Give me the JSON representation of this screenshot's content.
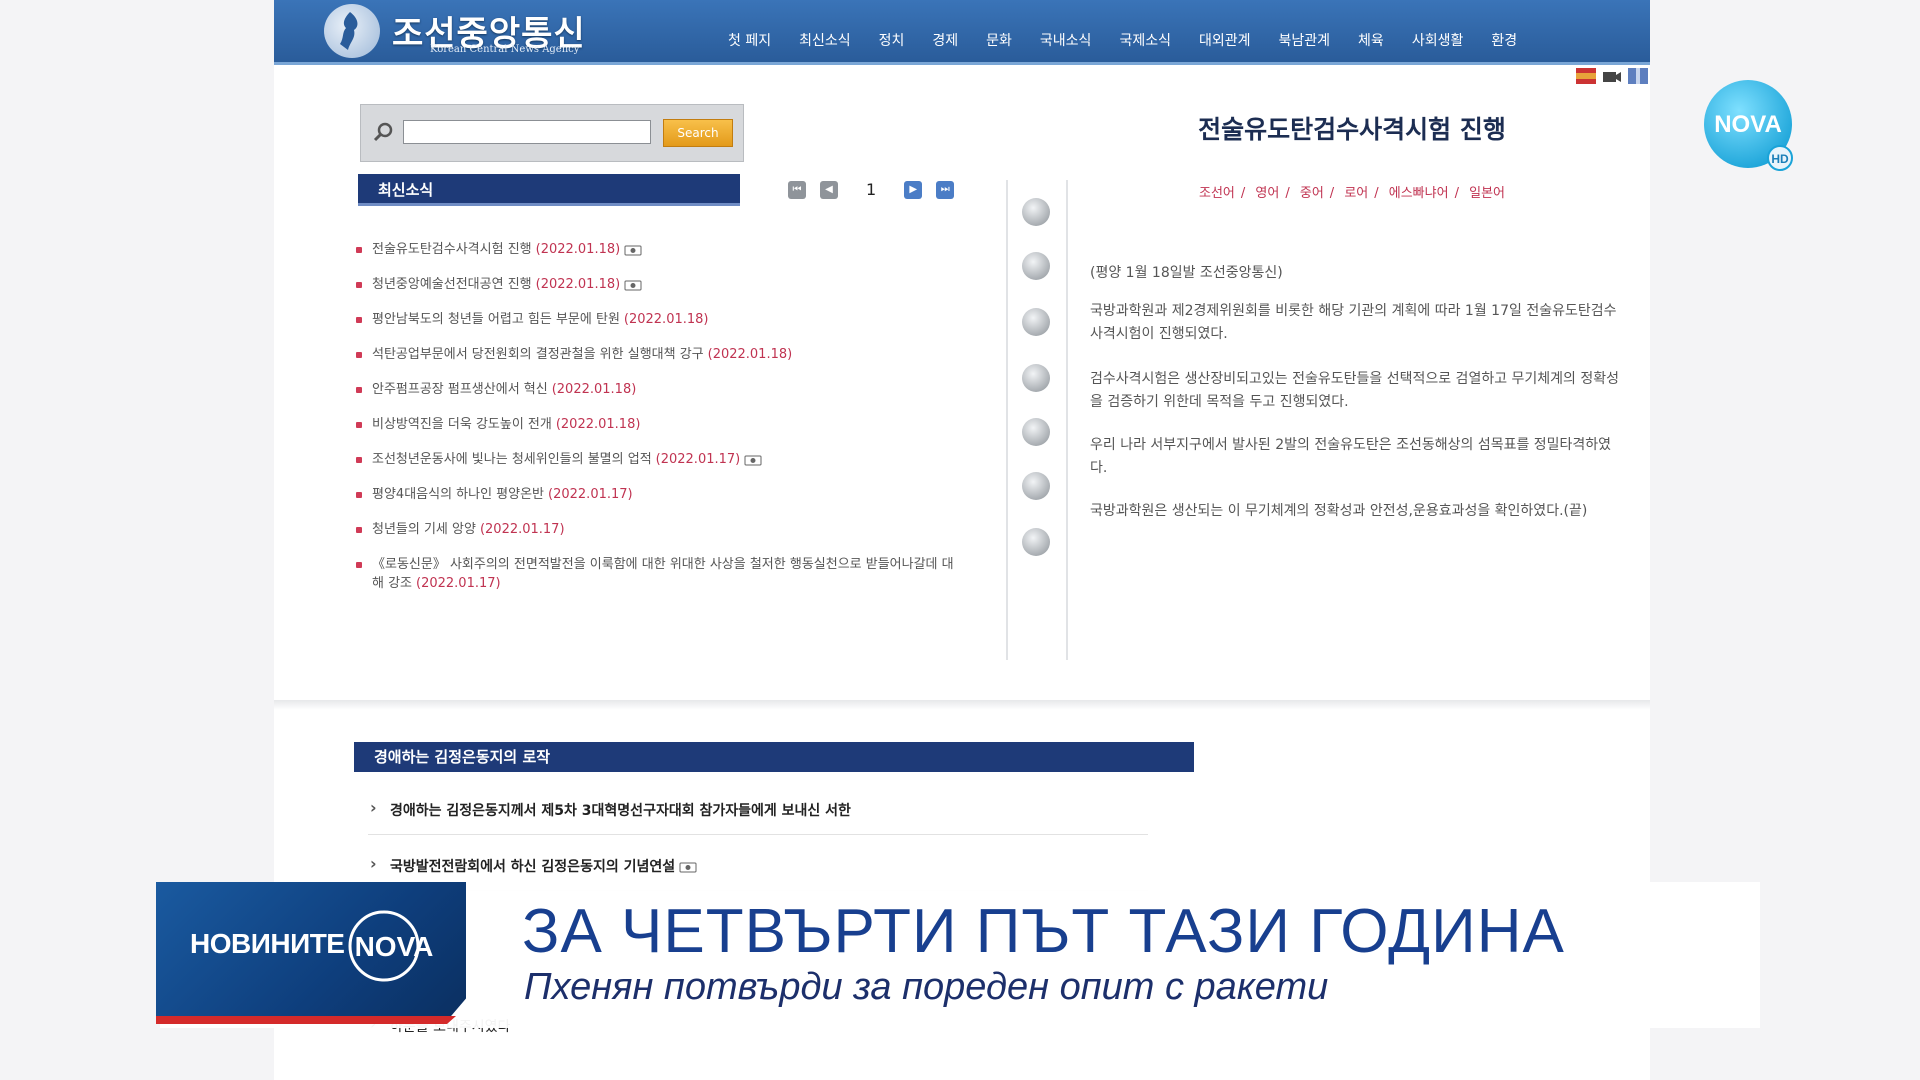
{
  "site": {
    "logo_title": "조선중앙통신",
    "logo_subtitle": "Korean Central News Agency",
    "nav": [
      "첫 페지",
      "최신소식",
      "정치",
      "경제",
      "문화",
      "국내소식",
      "국제소식",
      "대외관계",
      "북남관계",
      "체육",
      "사회생활",
      "환경"
    ],
    "search": {
      "placeholder": "",
      "button": "Search"
    },
    "latest_news": {
      "header": "최신소식",
      "page": "1",
      "items": [
        {
          "title": "전술유도탄검수사격시험 진행",
          "date": "(2022.01.18)",
          "photo": true
        },
        {
          "title": "청년중앙예술선전대공연 진행",
          "date": "(2022.01.18)",
          "photo": true
        },
        {
          "title": "평안남북도의 청년들 어렵고 힘든 부문에 탄원",
          "date": "(2022.01.18)",
          "photo": false
        },
        {
          "title": "석탄공업부문에서 당전원회의 결정관철을 위한 실행대책 강구",
          "date": "(2022.01.18)",
          "photo": false
        },
        {
          "title": "안주펌프공장 펌프생산에서 혁신",
          "date": "(2022.01.18)",
          "photo": false
        },
        {
          "title": "비상방역진을 더욱 강도높이 전개",
          "date": "(2022.01.18)",
          "photo": false
        },
        {
          "title": "조선청년운동사에 빛나는 청세위인들의 불멸의 업적",
          "date": "(2022.01.17)",
          "photo": true
        },
        {
          "title": "평양4대음식의 하나인 평양온반",
          "date": "(2022.01.17)",
          "photo": false
        },
        {
          "title": "청년들의 기세 앙양",
          "date": "(2022.01.17)",
          "photo": false
        },
        {
          "title": "《로동신문》 사회주의의 전면적발전을 이룩함에 대한 위대한 사상을 철저한 행동실천으로 받들어나갈데 대해 강조",
          "date": "(2022.01.17)",
          "photo": false
        }
      ]
    },
    "article": {
      "title": "전술유도탄검수사격시험 진행",
      "languages": [
        "조선어",
        "영어",
        "중어",
        "로어",
        "에스빠냐어",
        "일본어"
      ],
      "dateline": "(평양 1월 18일발 조선중앙통신)",
      "paragraphs": [
        "국방과학원과 제2경제위원회를 비롯한 해당 기관의 계획에 따라 1월 17일 전술유도탄검수사격시험이 진행되였다.",
        "검수사격시험은 생산장비되고있는 전술유도탄들을 선택적으로 검열하고 무기체계의 정확성을 검증하기 위한데 목적을 두고 진행되였다.",
        "우리 나라 서부지구에서 발사된 2발의 전술유도탄은 조선동해상의 섬목표를 정밀타격하였다.",
        "국방과학원은 생산되는 이 무기체계의 정확성과 안전성,운용효과성을 확인하였다.(끝)"
      ]
    },
    "kju_section": {
      "header": "경애하는 김정은동지의 로작",
      "items": [
        "경애하는 김정은동지께서 제5차 3대혁명선구자대회 참가자들에게 보내신 서한",
        "국방발전전람회에서 하신 김정은동지의 기념연설"
      ],
      "last_item": "하분을 보내주시였다"
    }
  },
  "overlay": {
    "channel_logo": "NOVA",
    "channel_hd": "HD",
    "badge_text": "НОВИНИТЕ",
    "badge_logo": "NOVA",
    "headline": "ЗА ЧЕТВЪРТИ ПЪТ ТАЗИ ГОДИНА",
    "subheadline": "Пхенян потвърди за пореден опит с ракети"
  },
  "colors": {
    "header_blue": "#2a5c9a",
    "section_navy": "#1e3a78",
    "date_red": "#c03351",
    "headline_blue": "#183f8f"
  }
}
